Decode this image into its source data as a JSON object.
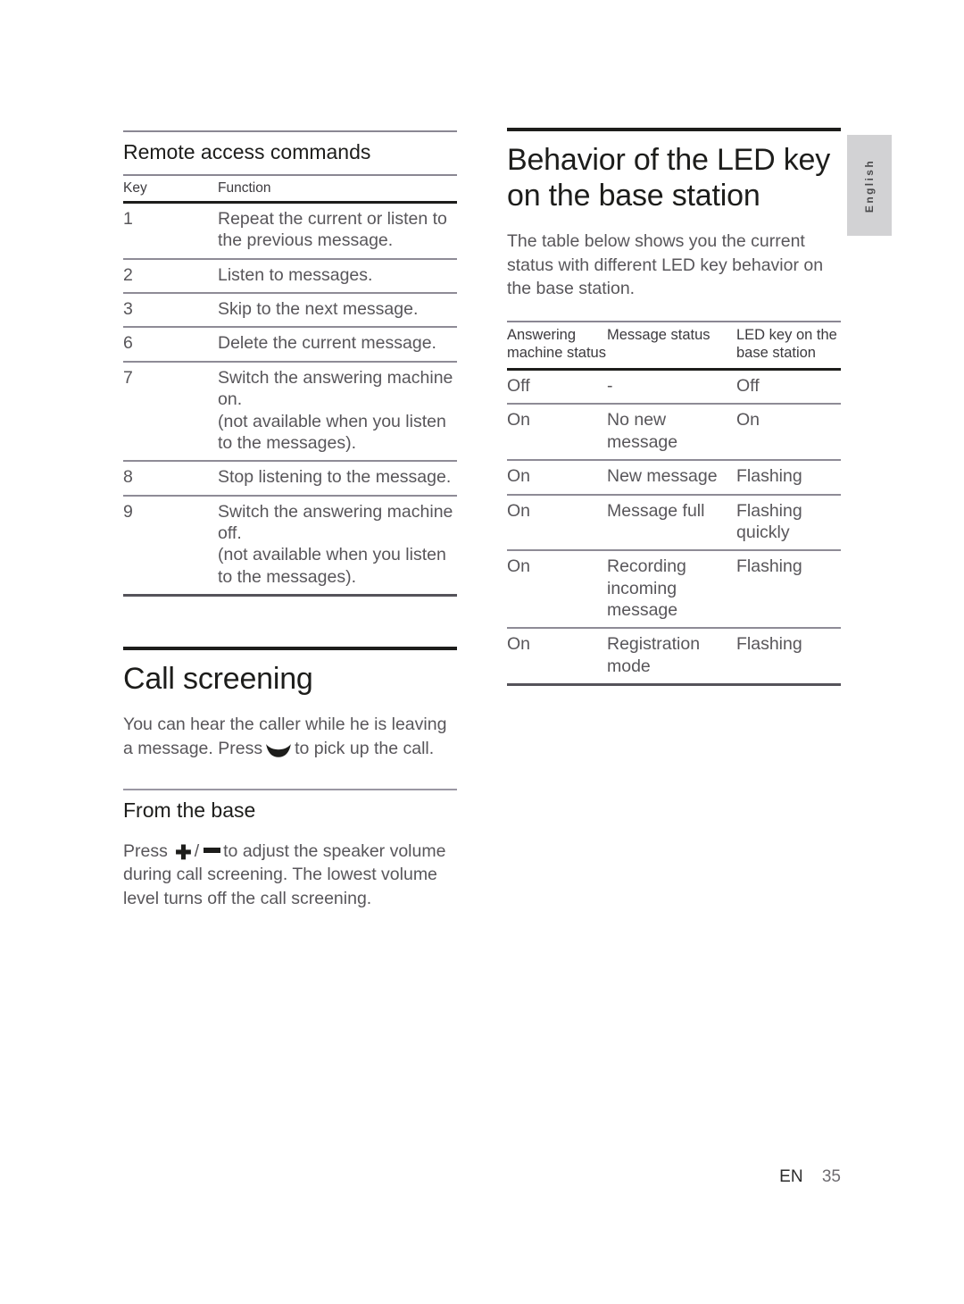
{
  "language_tab": "English",
  "footer": {
    "locale": "EN",
    "page_number": "35"
  },
  "left_column": {
    "remote_access": {
      "heading": "Remote access commands",
      "table": {
        "headers": [
          "Key",
          "Function"
        ],
        "rows": [
          [
            "1",
            "Repeat the current or listen to the previous message."
          ],
          [
            "2",
            "Listen to messages."
          ],
          [
            "3",
            "Skip to the next message."
          ],
          [
            "6",
            "Delete the current message."
          ],
          [
            "7",
            "Switch the answering machine on.\n(not available when you listen to the messages)."
          ],
          [
            "8",
            "Stop listening to the message."
          ],
          [
            "9",
            "Switch the answering machine off.\n(not available when you listen to the messages)."
          ]
        ]
      }
    },
    "call_screening": {
      "heading": "Call screening",
      "intro_before_icon": "You can hear the caller while he is leaving a message. Press",
      "intro_after_icon": "to pick up the call.",
      "handset_icon": "phone-handset-icon",
      "from_the_base": {
        "heading": "From the base",
        "text_before_icons": "Press",
        "plus_icon": "plus-icon",
        "separator": "/",
        "minus_icon": "minus-icon",
        "text_after_icons": "to adjust the speaker volume during call screening. The lowest volume level turns off the call screening."
      }
    }
  },
  "right_column": {
    "led_behavior": {
      "heading": "Behavior of the LED key on the base station",
      "intro": "The table below shows you the current status with different LED key behavior on the base station.",
      "table": {
        "headers": [
          "Answering machine status",
          "Message status",
          "LED key on the base station"
        ],
        "rows": [
          [
            "Off",
            "-",
            "Off"
          ],
          [
            "On",
            "No new message",
            "On"
          ],
          [
            "On",
            "New message",
            "Flashing"
          ],
          [
            "On",
            "Message full",
            "Flashing quickly"
          ],
          [
            "On",
            "Recording incoming message",
            "Flashing"
          ],
          [
            "On",
            "Registration mode",
            "Flashing"
          ]
        ]
      }
    }
  }
}
